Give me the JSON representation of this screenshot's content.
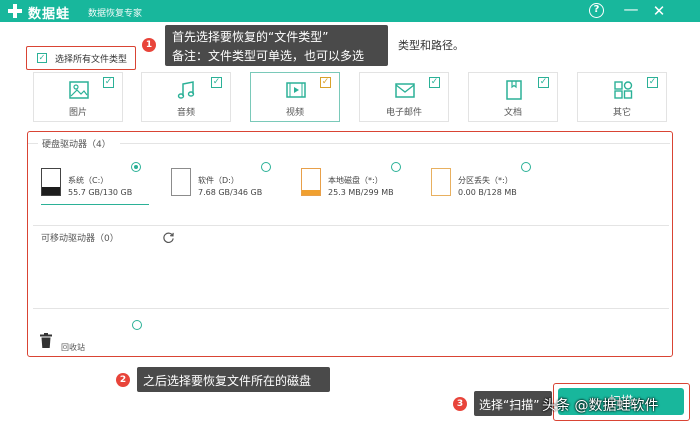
{
  "app": {
    "name": "数据蛙",
    "subtitle": "数据恢复专家",
    "help_icon": "question-circle-icon",
    "brand_color": "#18b79c"
  },
  "instruction_partial": "类型和路径。",
  "select_all": {
    "label": "选择所有文件类型",
    "checked": true
  },
  "file_types": [
    {
      "label": "图片",
      "icon": "image-icon",
      "checked": true,
      "active": false
    },
    {
      "label": "音频",
      "icon": "music-icon",
      "checked": true,
      "active": false
    },
    {
      "label": "视频",
      "icon": "video-icon",
      "checked": true,
      "active": true
    },
    {
      "label": "电子邮件",
      "icon": "mail-icon",
      "checked": true,
      "active": false
    },
    {
      "label": "文档",
      "icon": "document-icon",
      "checked": true,
      "active": false
    },
    {
      "label": "其它",
      "icon": "grid-icon",
      "checked": true,
      "active": false
    }
  ],
  "hard_drives": {
    "title": "硬盘驱动器（4）",
    "drives": [
      {
        "name": "系统（C:）",
        "size": "55.7 GB/130 GB",
        "selected": true
      },
      {
        "name": "软件（D:）",
        "size": "7.68 GB/346 GB",
        "selected": false
      },
      {
        "name": "本地磁盘（*:）",
        "size": "25.3 MB/299 MB",
        "selected": false
      },
      {
        "name": "分区丢失（*:）",
        "size": "0.00  B/128 MB",
        "selected": false
      }
    ]
  },
  "removable": {
    "title": "可移动驱动器（0）",
    "refresh_icon": "refresh-icon"
  },
  "recycle_bin": {
    "label": "回收站",
    "icon": "trash-icon",
    "selected": false
  },
  "callouts": {
    "step1_num": "1",
    "step1_line1": "首先选择要恢复的“文件类型”",
    "step1_line2": "备注：文件类型可单选，也可以多选",
    "step2_num": "2",
    "step2_text": "之后选择要恢复文件所在的磁盘",
    "step3_num": "3",
    "step3_text": "选择“扫描”"
  },
  "scan_button": {
    "label": "扫描"
  },
  "watermark": "头条 @数据蛙软件"
}
